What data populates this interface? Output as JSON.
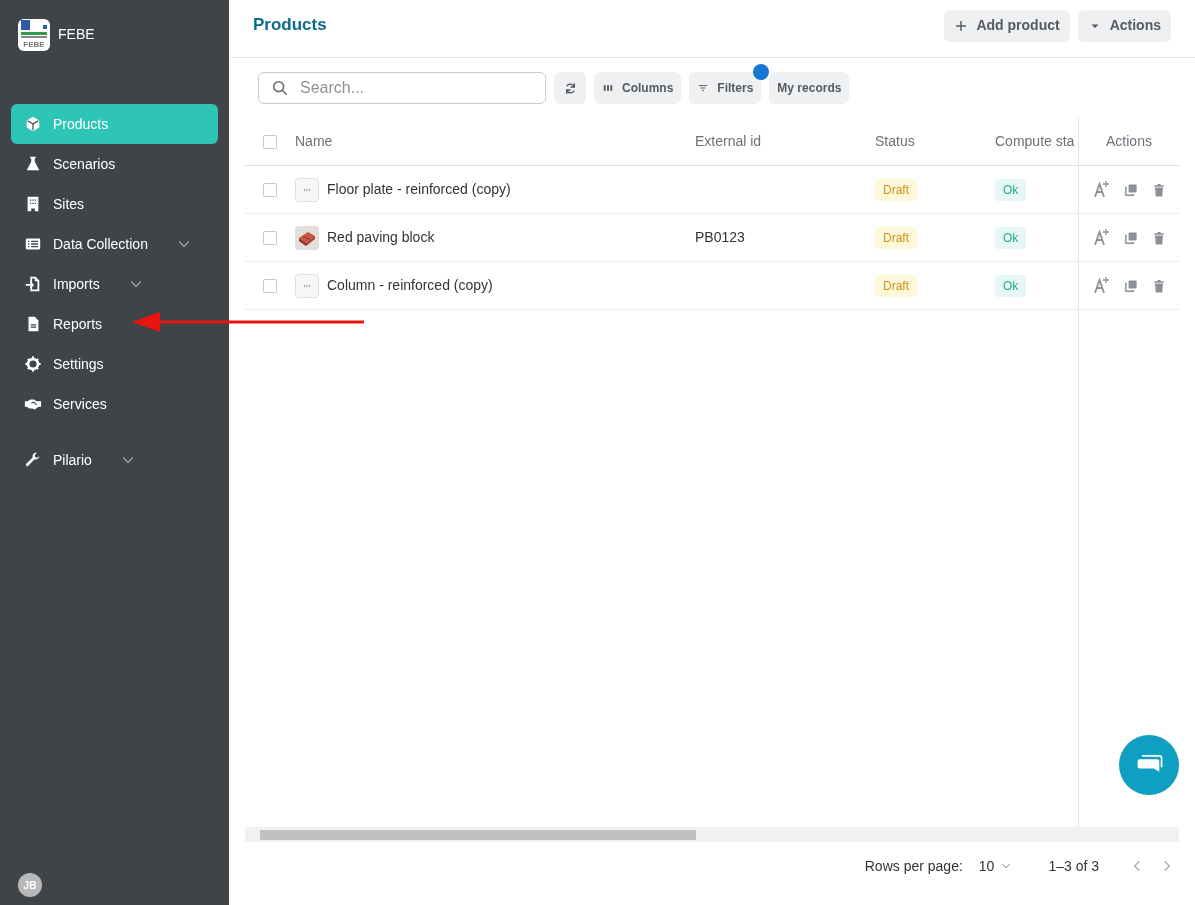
{
  "brand": {
    "logo_text": "FEBE",
    "name": "FEBE"
  },
  "sidebar": {
    "items": [
      {
        "label": "Products",
        "selected": true,
        "expandable": false
      },
      {
        "label": "Scenarios",
        "selected": false,
        "expandable": false
      },
      {
        "label": "Sites",
        "selected": false,
        "expandable": false
      },
      {
        "label": "Data Collection",
        "selected": false,
        "expandable": true
      },
      {
        "label": "Imports",
        "selected": false,
        "expandable": true
      },
      {
        "label": "Reports",
        "selected": false,
        "expandable": false
      },
      {
        "label": "Settings",
        "selected": false,
        "expandable": false
      },
      {
        "label": "Services",
        "selected": false,
        "expandable": false
      },
      {
        "label": "Pilario",
        "selected": false,
        "expandable": true
      }
    ],
    "user_initials": "JB"
  },
  "header": {
    "title": "Products",
    "buttons": [
      {
        "label": "Add product"
      },
      {
        "label": "Actions"
      }
    ]
  },
  "toolbar": {
    "search": {
      "placeholder": "Search..."
    },
    "buttons": [
      {
        "label": "Columns"
      },
      {
        "label": "Filters",
        "badge": true
      },
      {
        "label": "My records"
      }
    ]
  },
  "table": {
    "all_checked": false,
    "columns": [
      "Name",
      "External id",
      "Status",
      "Compute sta",
      "Actions"
    ],
    "rows": [
      {
        "checked": false,
        "thumbnail": {
          "kind": "placeholder"
        },
        "name": "Floor plate - reinforced (copy)",
        "external_id": "",
        "status": "Draft",
        "compute_status": "Ok"
      },
      {
        "checked": false,
        "name": "Red paving block",
        "external_id": "PB0123",
        "status": "Draft",
        "compute_status": "Ok"
      },
      {
        "checked": false,
        "thumbnail": {
          "kind": "placeholder"
        },
        "name": "Column - reinforced (copy)",
        "external_id": "",
        "status": "Draft",
        "compute_status": "Ok"
      }
    ]
  },
  "pagination": {
    "rows_per_page_label": "Rows per page:",
    "rows_per_page": "10",
    "range": "1–3 of 3"
  }
}
